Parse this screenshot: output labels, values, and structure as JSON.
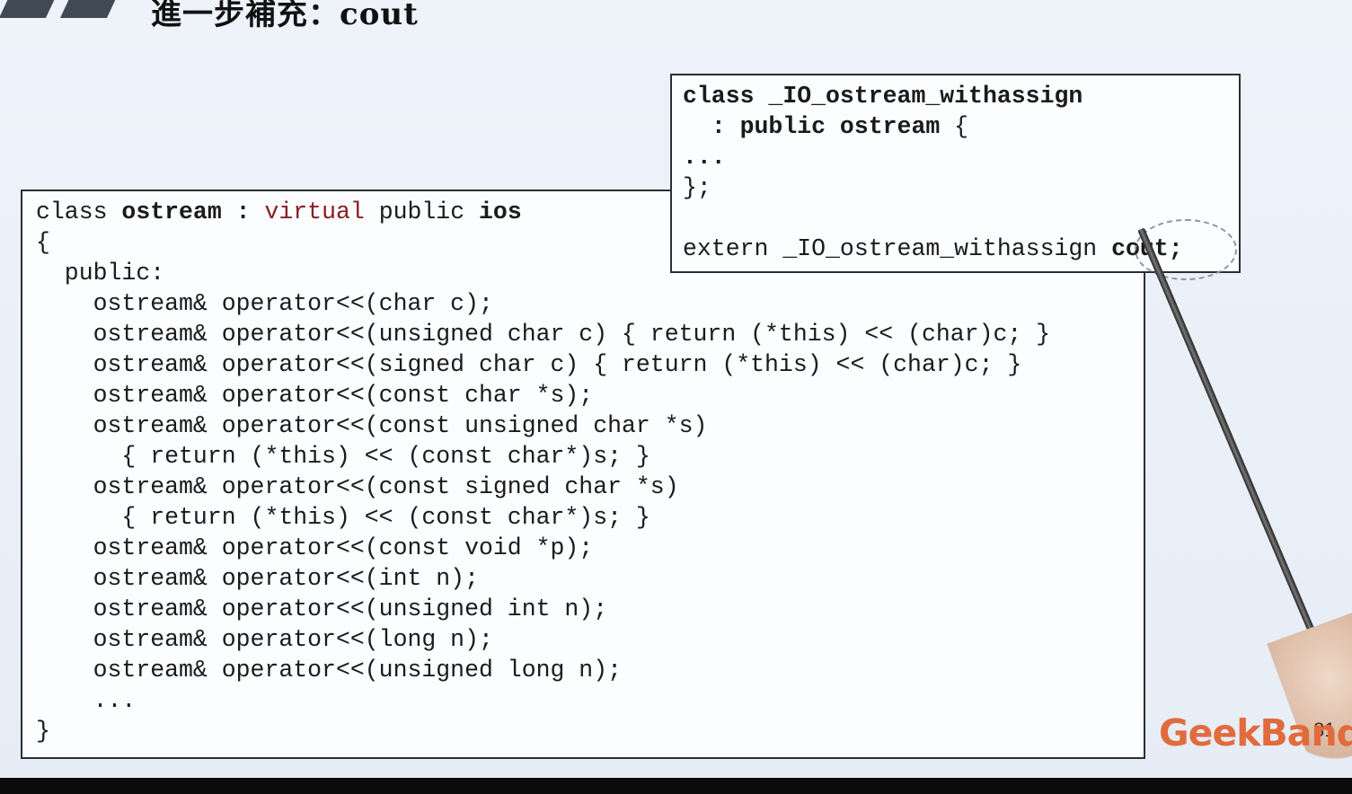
{
  "slide": {
    "title": "進一步補充：cout",
    "page_number": "81",
    "logo_text": "GeekBand"
  },
  "top_box": {
    "lines": [
      "class _IO_ostream_withassign",
      "  : public ostream {",
      "...",
      "};",
      "",
      "extern _IO_ostream_withassign cout;"
    ]
  },
  "main_box": {
    "lines": [
      "class ostream : virtual public ios",
      "{",
      "  public:",
      "    ostream& operator<<(char c);",
      "    ostream& operator<<(unsigned char c) { return (*this) << (char)c; }",
      "    ostream& operator<<(signed char c) { return (*this) << (char)c; }",
      "    ostream& operator<<(const char *s);",
      "    ostream& operator<<(const unsigned char *s)",
      "      { return (*this) << (const char*)s; }",
      "    ostream& operator<<(const signed char *s)",
      "      { return (*this) << (const char*)s; }",
      "    ostream& operator<<(const void *p);",
      "    ostream& operator<<(int n);",
      "    ostream& operator<<(unsigned int n);",
      "    ostream& operator<<(long n);",
      "    ostream& operator<<(unsigned long n);",
      "    ...",
      "}"
    ]
  },
  "colors": {
    "keyword_red": "#8a1e22",
    "logo_orange": "#e26b3c",
    "box_border": "#2b2f33"
  }
}
